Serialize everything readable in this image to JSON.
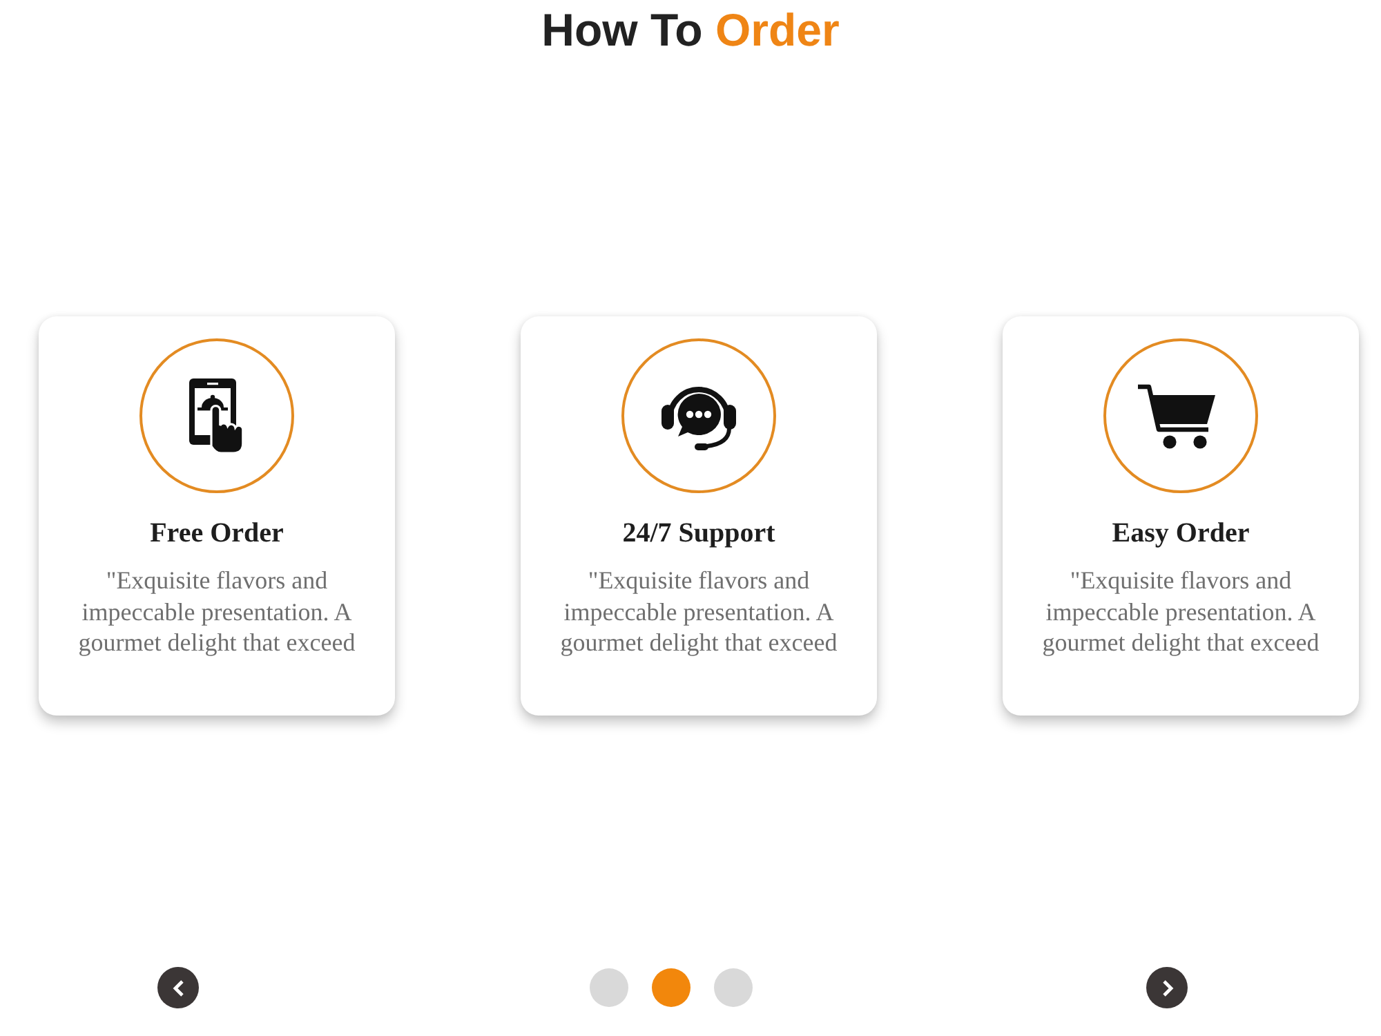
{
  "heading": {
    "text": "How To",
    "highlight": "Order"
  },
  "cards": [
    {
      "kind": "mobile",
      "title": "Free Order",
      "text": "\"Exquisite flavors and impeccable presentation. A gourmet delight that exceed"
    },
    {
      "kind": "support",
      "title": "24/7 Support",
      "text": "\"Exquisite flavors and impeccable presentation. A gourmet delight that exceed"
    },
    {
      "kind": "cart",
      "title": "Easy Order",
      "text": "\"Exquisite flavors and impeccable presentation. A gourmet delight that exceed"
    }
  ],
  "carousel": {
    "dots": [
      {
        "selected": false
      },
      {
        "selected": true
      },
      {
        "selected": false
      }
    ]
  }
}
